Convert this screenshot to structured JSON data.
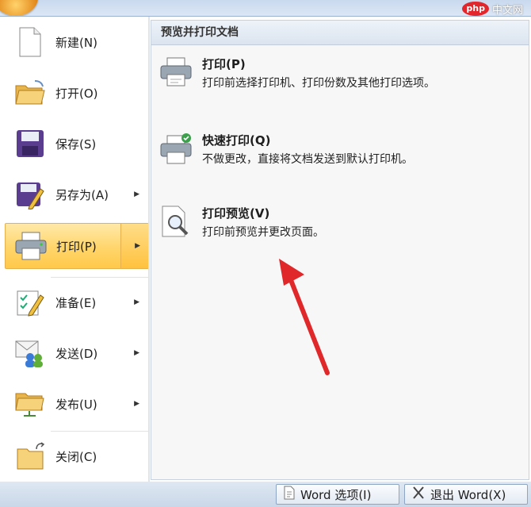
{
  "watermark": {
    "logo": "php",
    "text": "中文网"
  },
  "menu": {
    "items": [
      {
        "label": "新建(N)",
        "icon": "new-document-icon",
        "has_submenu": false
      },
      {
        "label": "打开(O)",
        "icon": "open-folder-icon",
        "has_submenu": false
      },
      {
        "label": "保存(S)",
        "icon": "save-disk-icon",
        "has_submenu": false
      },
      {
        "label": "另存为(A)",
        "icon": "save-as-icon",
        "has_submenu": true
      },
      {
        "label": "打印(P)",
        "icon": "printer-icon",
        "has_submenu": true,
        "selected": true
      },
      {
        "label": "准备(E)",
        "icon": "prepare-pen-icon",
        "has_submenu": true
      },
      {
        "label": "发送(D)",
        "icon": "send-users-icon",
        "has_submenu": true
      },
      {
        "label": "发布(U)",
        "icon": "publish-folder-icon",
        "has_submenu": true
      },
      {
        "label": "关闭(C)",
        "icon": "close-folder-icon",
        "has_submenu": false
      }
    ]
  },
  "panel": {
    "header": "预览并打印文档",
    "options": [
      {
        "title": "打印(P)",
        "desc": "打印前选择打印机、打印份数及其他打印选项。",
        "icon": "printer-icon"
      },
      {
        "title": "快速打印(Q)",
        "desc": "不做更改，直接将文档发送到默认打印机。",
        "icon": "quick-print-icon"
      },
      {
        "title": "打印预览(V)",
        "desc": "打印前预览并更改页面。",
        "icon": "print-preview-icon"
      }
    ]
  },
  "footer": {
    "word_options": "Word 选项(I)",
    "exit_word": "退出 Word(X)"
  },
  "colors": {
    "selection": "#ffd56a",
    "annotation_arrow": "#e0282a"
  }
}
